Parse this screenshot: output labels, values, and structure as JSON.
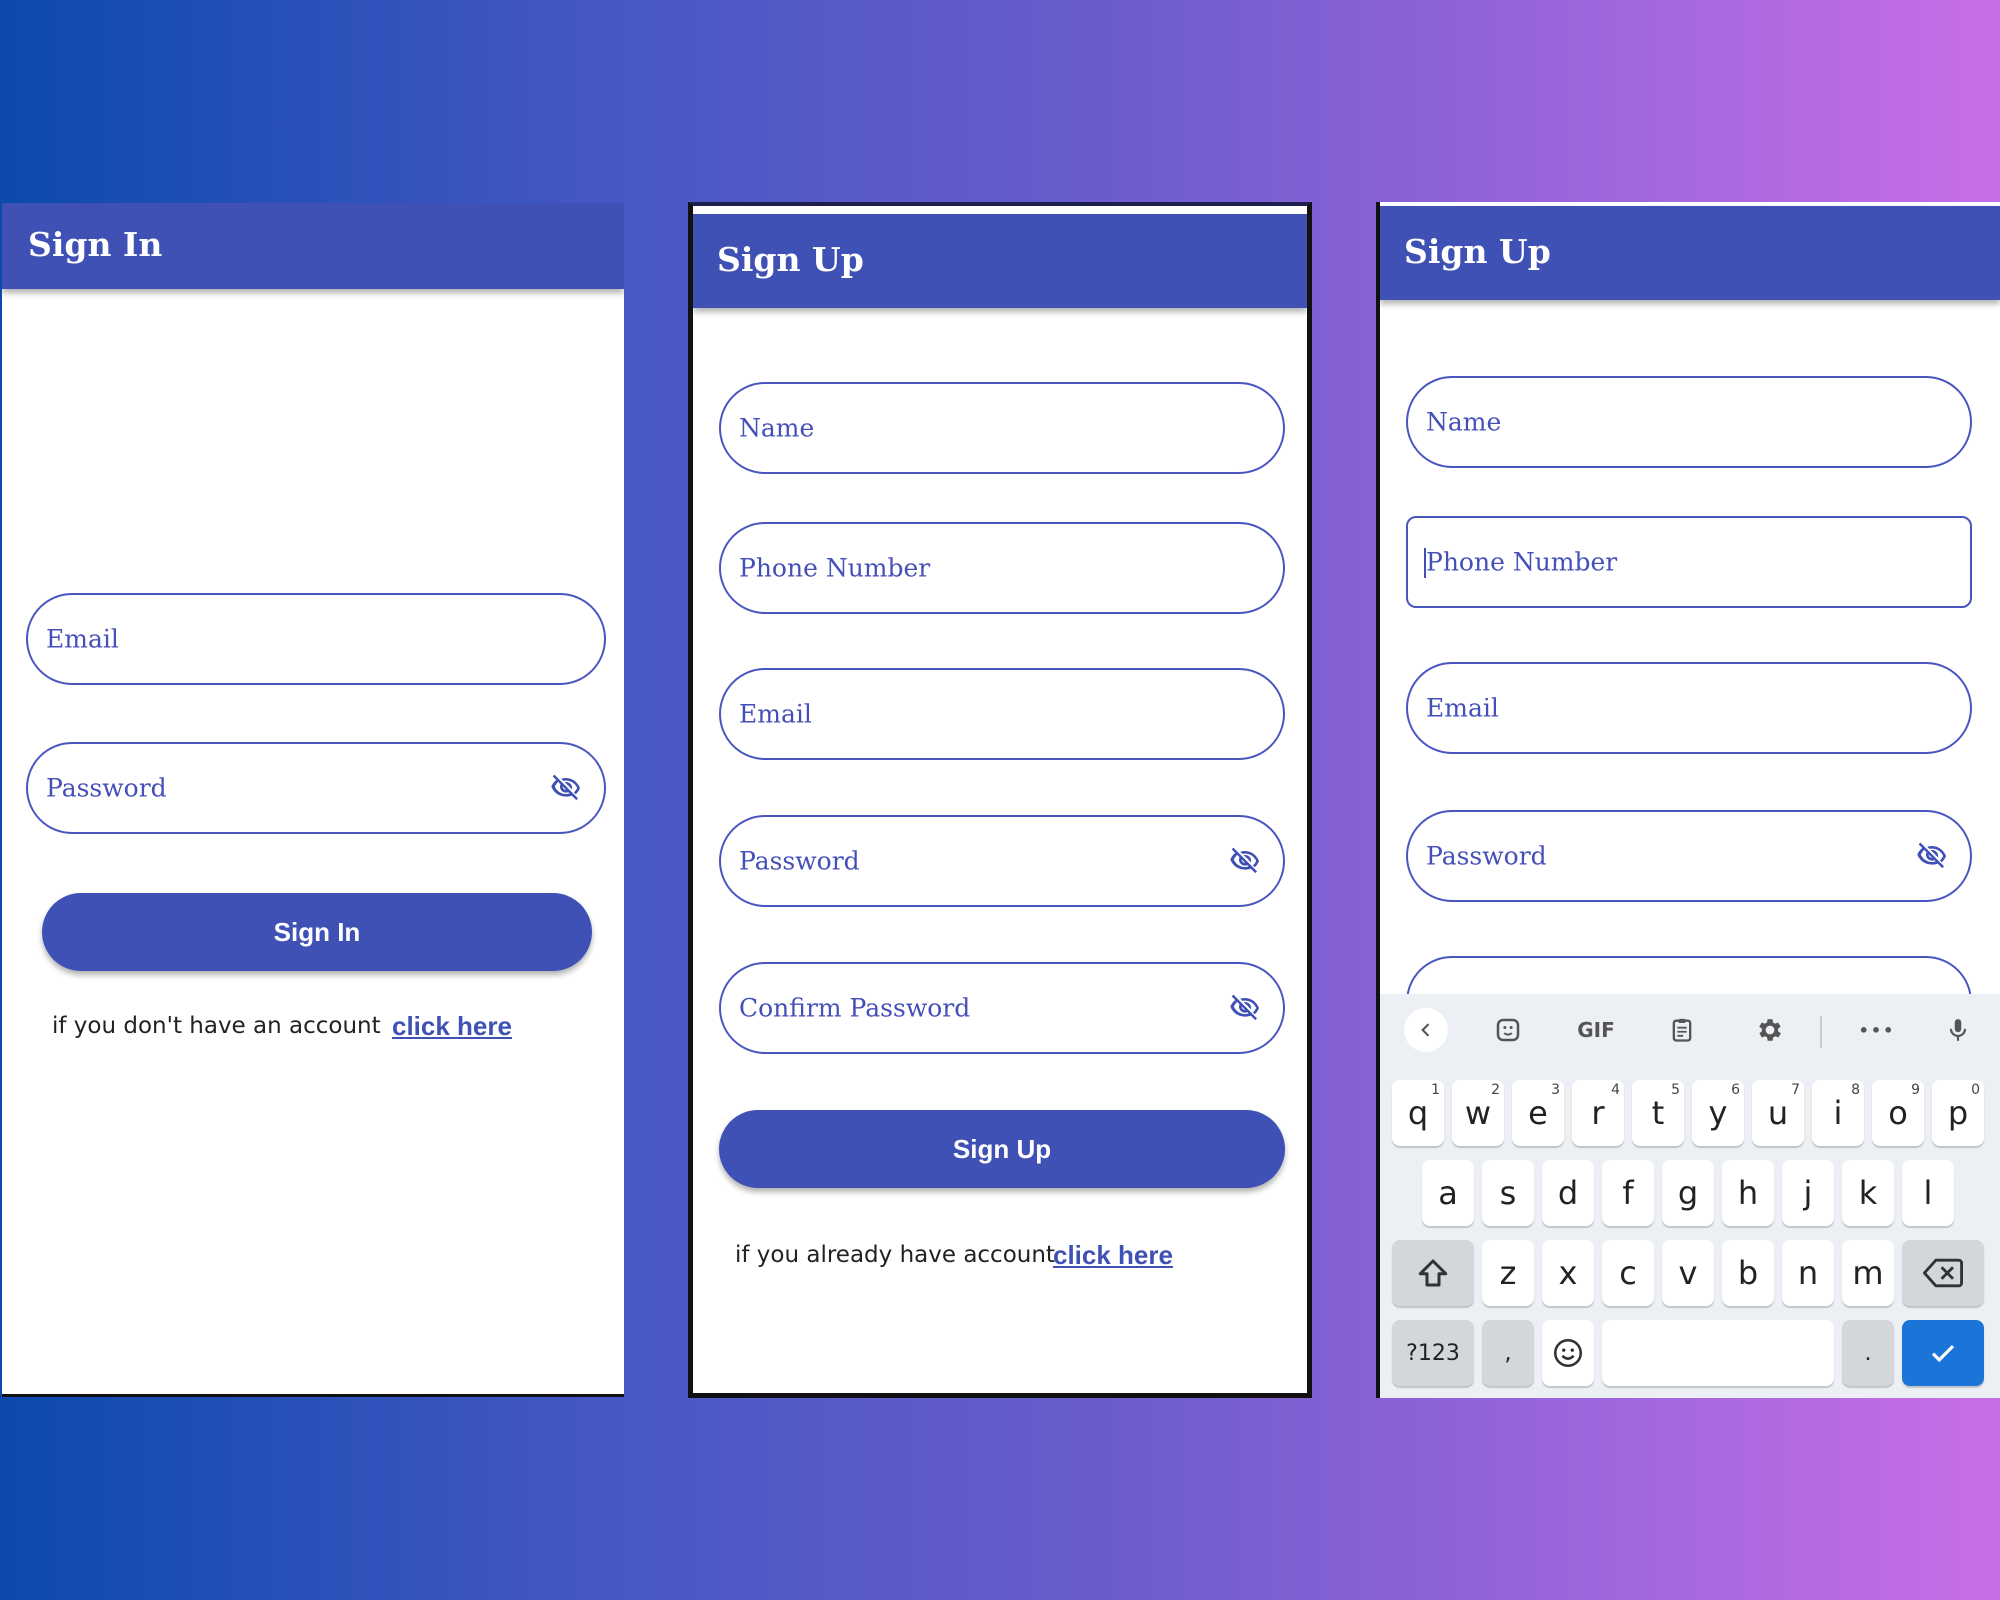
{
  "screen_sign_in": {
    "title": "Sign In",
    "email_label": "Email",
    "password_label": "Password",
    "button_label": "Sign In",
    "footer_text": "if you don't have an  account",
    "footer_link": "click here"
  },
  "screen_sign_up": {
    "title": "Sign Up",
    "name_label": "Name",
    "phone_label": "Phone Number",
    "email_label": "Email",
    "password_label": "Password",
    "confirm_password_label": "Confirm Password",
    "button_label": "Sign Up",
    "footer_text": "if you already have account",
    "footer_link": "click here"
  },
  "screen_sign_up_keyboard": {
    "title": "Sign Up",
    "name_label": "Name",
    "phone_label": "Phone Number",
    "email_label": "Email",
    "password_label": "Password",
    "keyboard": {
      "toolbar": [
        "chevron-left",
        "sticker",
        "GIF",
        "clipboard",
        "settings",
        "more",
        "mic"
      ],
      "gif_label": "GIF",
      "more_label": "•••",
      "row1": [
        "q",
        "w",
        "e",
        "r",
        "t",
        "y",
        "u",
        "i",
        "o",
        "p"
      ],
      "row1_hints": [
        "1",
        "2",
        "3",
        "4",
        "5",
        "6",
        "7",
        "8",
        "9",
        "0"
      ],
      "row2": [
        "a",
        "s",
        "d",
        "f",
        "g",
        "h",
        "j",
        "k",
        "l"
      ],
      "row3": [
        "z",
        "x",
        "c",
        "v",
        "b",
        "n",
        "m"
      ],
      "symbols_label": "?123",
      "comma_label": ",",
      "period_label": "."
    }
  },
  "colors": {
    "primary": "#3f51b5",
    "field_border": "#4a55c0",
    "keyboard_bg": "#eceff3",
    "enter_key": "#1b74d8"
  }
}
